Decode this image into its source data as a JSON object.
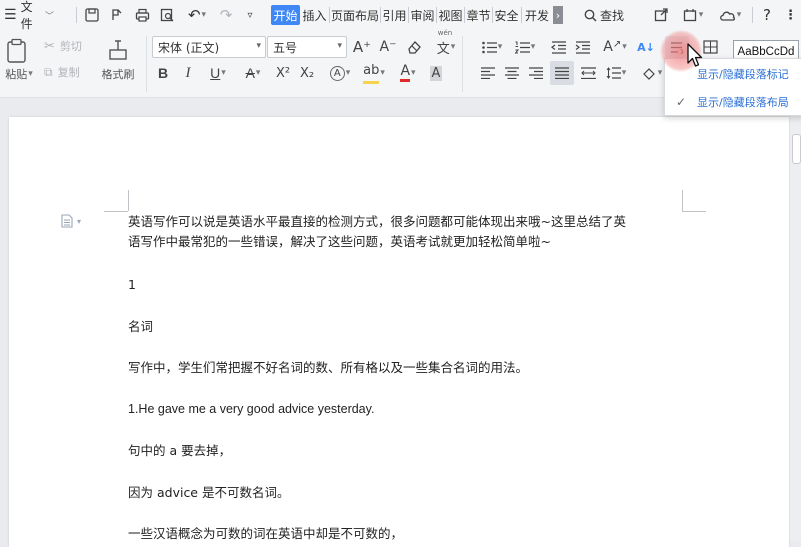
{
  "menubar": {
    "file_label": "文件",
    "tabs": [
      "开始",
      "插入",
      "页面布局",
      "引用",
      "审阅",
      "视图",
      "章节",
      "安全",
      "开发"
    ],
    "active_tab": "开始",
    "more_tabs_glyph": "›",
    "search_label": "查找"
  },
  "ribbon": {
    "paste_label": "粘贴",
    "cut_label": "剪切",
    "copy_label": "复制",
    "format_painter_label": "格式刷",
    "font_name": "宋体 (正文)",
    "font_size": "五号",
    "bold": "B",
    "italic": "I",
    "underline": "U",
    "strike": "A",
    "superscript": "X²",
    "subscript": "X₂",
    "increase_font": "A⁺",
    "decrease_font": "A⁻",
    "phonetic_glyph": "文",
    "style_preview": "AaBbCcDd"
  },
  "dropdown": {
    "items": [
      {
        "label": "显示/隐藏段落标记",
        "checked": false
      },
      {
        "label": "显示/隐藏段落布局",
        "checked": true
      }
    ]
  },
  "document": {
    "paragraphs": [
      "英语写作可以说是英语水平最直接的检测方式，很多问题都可能体现出来哦~这里总结了英",
      "语写作中最常犯的一些错误，解决了这些问题，英语考试就更加轻松简单啦~",
      "1",
      "名词",
      "写作中，学生们常把握不好名词的数、所有格以及一些集合名词的用法。",
      "1.He gave me a very good advice yesterday.",
      "句中的 a 要去掉，",
      "因为 advice 是不可数名词。",
      "一些汉语概念为可数的词在英语中却是不可数的，"
    ]
  },
  "colors": {
    "accent": "#3f87f5",
    "highlight_fill": "#f5d44a",
    "font_color": "#e02a2a"
  }
}
